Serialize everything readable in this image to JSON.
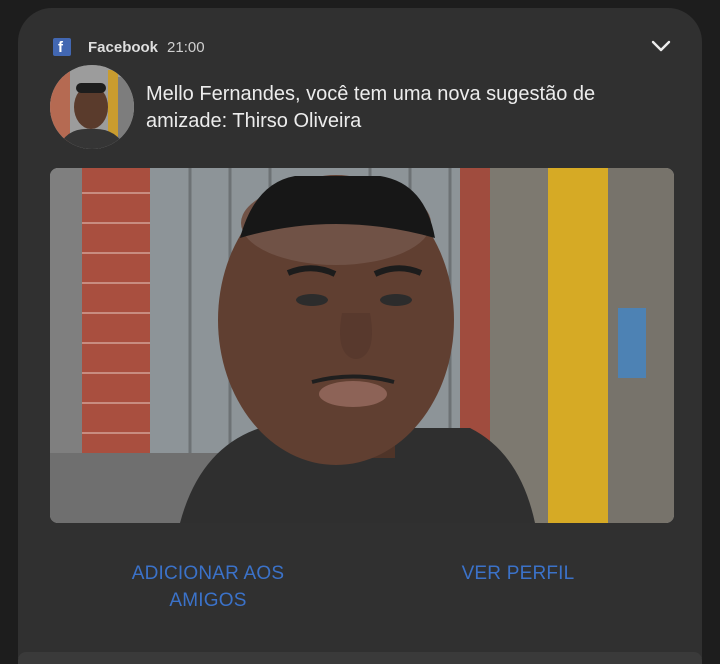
{
  "notification": {
    "app_name": "Facebook",
    "time": "21:00",
    "app_icon": "facebook-icon",
    "expand_icon": "chevron-down-icon",
    "message": "Mello Fernandes, você tem uma nova sugestão de amizade: Thirso Oliveira",
    "actions": {
      "add_friend": "ADICIONAR AOS AMIGOS",
      "view_profile": "VER PERFIL"
    }
  },
  "colors": {
    "card_background": "#303030",
    "action_text": "#3b72c9",
    "facebook_blue": "#4267b2"
  }
}
